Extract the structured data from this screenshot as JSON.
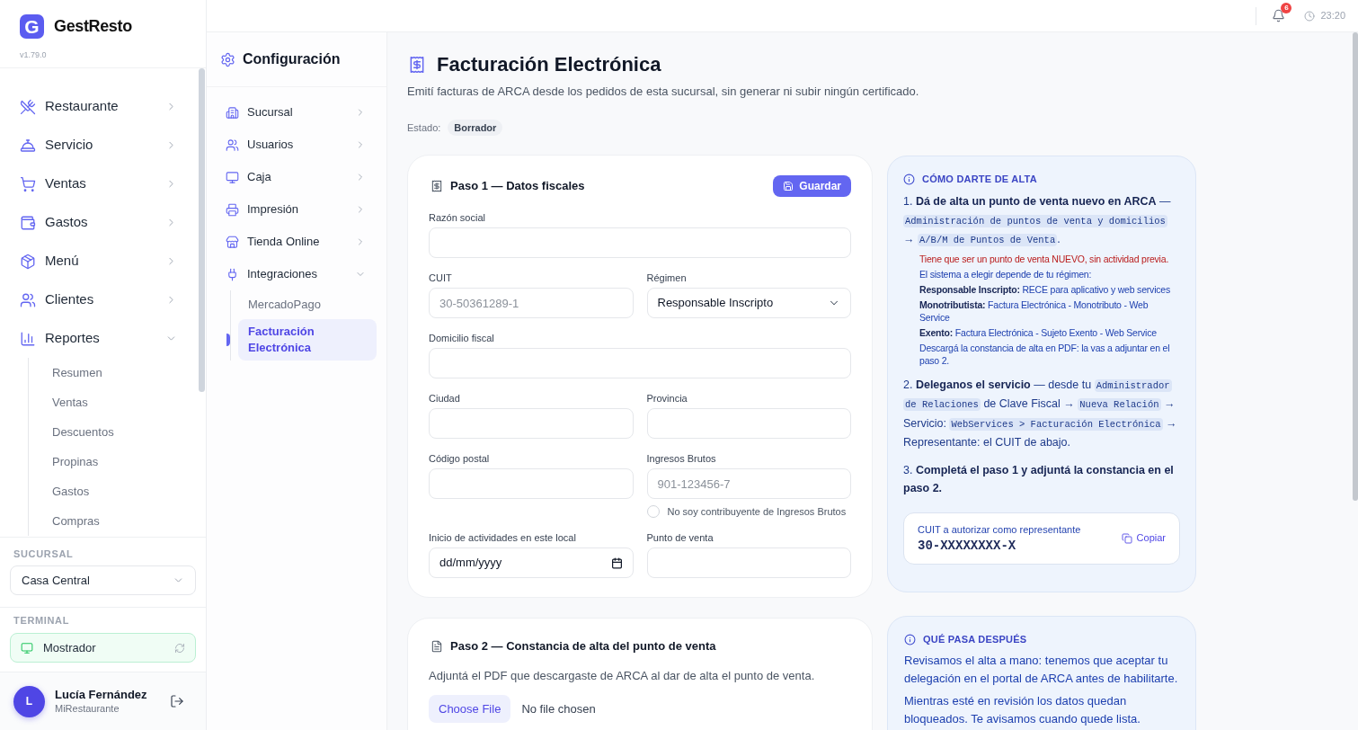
{
  "sidebar": {
    "logo_letter": "G",
    "app_name": "GestResto",
    "version": "v1.79.0",
    "nav": [
      {
        "label": "Restaurante",
        "expanded": false
      },
      {
        "label": "Servicio",
        "expanded": false
      },
      {
        "label": "Ventas",
        "expanded": false
      },
      {
        "label": "Gastos",
        "expanded": false
      },
      {
        "label": "Menú",
        "expanded": false
      },
      {
        "label": "Clientes",
        "expanded": false
      },
      {
        "label": "Reportes",
        "expanded": true,
        "children": [
          {
            "label": "Resumen",
            "selected": false
          },
          {
            "label": "Ventas",
            "selected": false
          },
          {
            "label": "Descuentos",
            "selected": false
          },
          {
            "label": "Propinas",
            "selected": false
          },
          {
            "label": "Gastos",
            "selected": false
          },
          {
            "label": "Compras",
            "selected": false
          }
        ]
      }
    ],
    "branch": {
      "label": "SUCURSAL",
      "value": "Casa Central"
    },
    "terminal": {
      "label": "TERMINAL",
      "value": "Mostrador"
    },
    "user": {
      "initial": "L",
      "name": "Lucía Fernández",
      "organization": "MiRestaurante"
    }
  },
  "top_bar": {
    "notifications": "6",
    "time": "23:20"
  },
  "settings_nav": {
    "title": "Configuración",
    "items": [
      {
        "label": "Sucursal",
        "expanded": false
      },
      {
        "label": "Usuarios",
        "expanded": false
      },
      {
        "label": "Caja",
        "expanded": false
      },
      {
        "label": "Impresión",
        "expanded": false
      },
      {
        "label": "Tienda Online",
        "expanded": false
      },
      {
        "label": "Integraciones",
        "expanded": true,
        "children": [
          {
            "label": "MercadoPago",
            "selected": false
          },
          {
            "label": "Facturación Electrónica",
            "selected": true
          }
        ]
      }
    ]
  },
  "page": {
    "title": "Facturación Electrónica",
    "subtitle": "Emití facturas de ARCA desde los pedidos de esta sucursal, sin generar ni subir ningún certificado.",
    "status": {
      "label": "Estado:",
      "value": "Borrador"
    }
  },
  "step_1": {
    "title": "Paso 1 — Datos fiscales",
    "save_button": "Guardar",
    "form_rows": [
      [
        {
          "kind": "text",
          "label": "Razón social"
        }
      ],
      [
        {
          "kind": "text",
          "label": "CUIT",
          "placeholder": "30-50361289-1"
        },
        {
          "kind": "select",
          "label": "Régimen",
          "value": "Responsable Inscripto"
        }
      ],
      [
        {
          "kind": "text",
          "label": "Domicilio fiscal"
        }
      ],
      [
        {
          "kind": "text",
          "label": "Ciudad"
        },
        {
          "kind": "text",
          "label": "Provincia"
        }
      ],
      [
        {
          "kind": "text",
          "label": "Código postal"
        },
        {
          "kind": "text",
          "label": "Ingresos Brutos",
          "placeholder": "901-123456-7",
          "option": {
            "label": "No soy contribuyente de Ingresos Brutos",
            "checked": false
          }
        }
      ],
      [
        {
          "kind": "date",
          "label": "Inicio de actividades en este local",
          "placeholder": "dd/mm/yyyy"
        },
        {
          "kind": "text",
          "label": "Punto de venta"
        }
      ]
    ]
  },
  "setup_guide": {
    "title": "CÓMO DARTE DE ALTA",
    "steps": [
      {
        "parts": [
          {
            "kind": "text",
            "text": "1. "
          },
          {
            "kind": "bold",
            "text": "Dá de alta un punto de venta nuevo en ARCA"
          },
          {
            "kind": "text",
            "text": " — "
          },
          {
            "kind": "code",
            "text": "Administración de puntos de venta y domicilios"
          },
          {
            "kind": "text",
            "text": " → "
          },
          {
            "kind": "code",
            "text": "A/B/M de Puntos de Venta"
          },
          {
            "kind": "text",
            "text": "."
          }
        ],
        "notes": [
          {
            "kind": "warning",
            "text": "Tiene que ser un punto de venta NUEVO, sin actividad previa."
          },
          {
            "kind": "plain",
            "text": "El sistema a elegir depende de tu régimen:"
          },
          {
            "kind": "plain",
            "text": "**Responsable Inscripto:** RECE para aplicativo y web services"
          },
          {
            "kind": "plain",
            "text": "**Monotributista:** Factura Electrónica - Monotributo - Web Service"
          },
          {
            "kind": "plain",
            "text": "**Exento:** Factura Electrónica - Sujeto Exento - Web Service"
          },
          {
            "kind": "plain",
            "text": "Descargá la constancia de alta en PDF: la vas a adjuntar en el paso 2."
          }
        ]
      },
      {
        "parts": [
          {
            "kind": "text",
            "text": "2. "
          },
          {
            "kind": "bold",
            "text": "Deleganos el servicio"
          },
          {
            "kind": "text",
            "text": " — desde tu "
          },
          {
            "kind": "code",
            "text": "Administrador de Relaciones"
          },
          {
            "kind": "text",
            "text": " de Clave Fiscal → "
          },
          {
            "kind": "code",
            "text": "Nueva Relación"
          },
          {
            "kind": "text",
            "text": " → Servicio: "
          },
          {
            "kind": "code",
            "text": "WebServices > Facturación Electrónica"
          },
          {
            "kind": "text",
            "text": " → Representante: el CUIT de abajo."
          }
        ]
      },
      {
        "parts": [
          {
            "kind": "text",
            "text": "3. "
          },
          {
            "kind": "bold",
            "text": "Completá el paso 1 y adjuntá la constancia en el paso 2."
          }
        ]
      }
    ],
    "cuit_box": {
      "label": "CUIT a autorizar como representante",
      "value": "30-XXXXXXXX-X",
      "copy_button": "Copiar"
    }
  },
  "step_2": {
    "title": "Paso 2 — Constancia de alta del punto de venta",
    "text": "Adjuntá el PDF que descargaste de ARCA al dar de alta el punto de venta.",
    "file_button": "Choose File",
    "file_status": "No file chosen"
  },
  "next_steps": {
    "title": "QUÉ PASA DESPUÉS",
    "paragraphs": [
      "Revisamos el alta a mano: tenemos que aceptar tu delegación en el portal de ARCA antes de habilitarte.",
      "Mientras esté en revisión los datos quedan bloqueados. Te avisamos cuando quede lista."
    ]
  }
}
